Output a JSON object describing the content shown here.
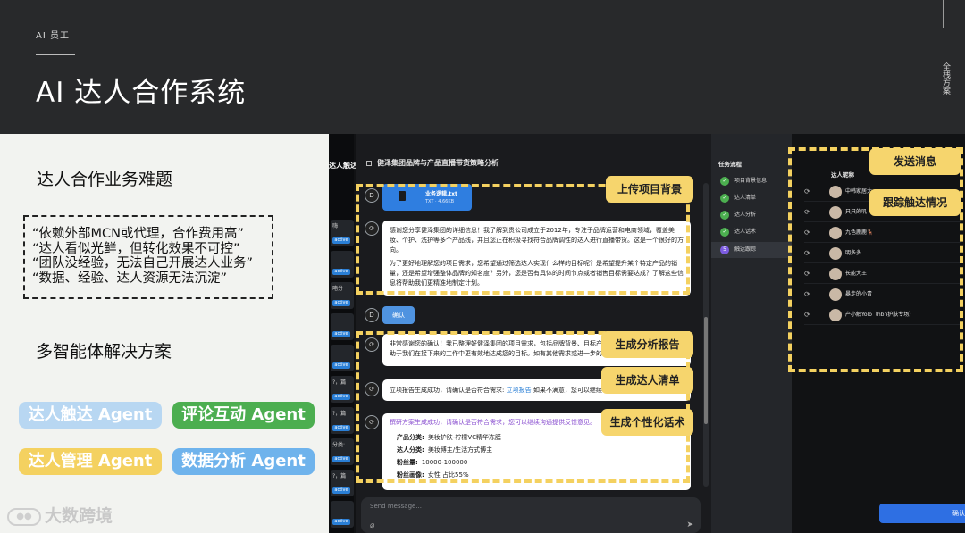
{
  "header": {
    "tag": "AI 员工",
    "title": "AI 达人合作系统",
    "side_text": "全栈方案"
  },
  "left": {
    "problems_title": "达人合作业务难题",
    "quotes": [
      "“依赖外部MCN或代理，合作费用高”",
      "“达人看似光鲜，但转化效果不可控”",
      "“团队没经验，无法自己开展达人业务”",
      "“数据、经验、达人资源无法沉淀”"
    ],
    "solution_title": "多智能体解决方案",
    "agents": [
      "达人触达 Agent",
      "评论互动 Agent",
      "达人管理 Agent",
      "数据分析 Agent"
    ],
    "logo_text": "大数跨境"
  },
  "app": {
    "brand": "达人触达",
    "sidebar_items": [
      {
        "text": "嗨",
        "badge": "active"
      },
      {
        "text": "",
        "badge": "active"
      },
      {
        "text": "略分",
        "badge": "active"
      },
      {
        "text": "",
        "badge": "active"
      },
      {
        "text": "",
        "badge": "active"
      },
      {
        "text": "?，篇",
        "badge": "active"
      },
      {
        "text": "?，篇",
        "badge": "active"
      },
      {
        "text": "分类:",
        "badge": "active"
      },
      {
        "text": "?，篇",
        "badge": "active"
      },
      {
        "text": "",
        "badge": "active"
      }
    ],
    "chat_title": "健泽集团品牌与产品直播带货策略分析",
    "user_avatar": "D",
    "file": {
      "name": "业务逻辑.txt",
      "meta": "TXT · 4.66KB"
    },
    "msg1_p1": "感谢您分享健泽集团的详细信息！我了解到贵公司成立于2012年，专注于品牌运营和电商领域，覆盖美妆、个护、洗护等多个产品线，并且您正在积极寻找符合品牌调性的达人进行直播带货。这是一个很好的方向。",
    "msg1_p2": "为了更好地理解您的项目需求，您希望通过筛选达人实现什么样的目标呢？是希望提升某个特定产品的销量，还是希望增强整体品牌的知名度？另外，您是否有具体的时间节点或者销售目标需要达成？了解这些信息将帮助我们更精准地制定计划。",
    "confirm": "确认",
    "msg2": "非常感谢您的确认！我已整理好健泽集团的项目需求，包括品牌背景、目标产品、达人筛选标准等。这将帮助于我们在接下来的工作中更有效地达成您的目标。如有其他需求或进一步的问题，",
    "msg3_pre": "立项报告生成成功，请确认是否符合需求: ",
    "msg3_link": "立项报告",
    "msg3_post": " 如果不满意，您可以继续",
    "msg4_head": "撰研方案生成成功，请确认是否符合需求，您可以继续沟通提供反馈意见。",
    "msg4_rows": [
      {
        "k": "产品分类:",
        "v": "美妆护肤-柠檬VC精华冻膜"
      },
      {
        "k": "达人分类:",
        "v": "美妆博主/生活方式博主"
      },
      {
        "k": "粉丝量:",
        "v": "10000-100000"
      },
      {
        "k": "粉丝画像:",
        "v": "女性 占比55%"
      }
    ],
    "input_placeholder": "Send message...",
    "tasks_title": "任务流程",
    "tasks": [
      {
        "label": "项目背景信息",
        "mark": "✓"
      },
      {
        "label": "达人清单",
        "mark": "✓"
      },
      {
        "label": "达人分析",
        "mark": "✓"
      },
      {
        "label": "达人话术",
        "mark": "✓"
      },
      {
        "label": "触达跟踪",
        "mark": "5"
      }
    ],
    "people_title": "达人昵称",
    "people": [
      "中韩家居大",
      "只只的叽",
      "九色鹿鹿🦌",
      "明多多",
      "长能大王",
      "暴走的小青",
      "产小触Yolo（hbn护肤专场）"
    ],
    "bottom_button": "确认"
  },
  "annotations": {
    "send_msg": "发送消息",
    "track": "跟踪触达情况",
    "upload": "上传项目背景",
    "report": "生成分析报告",
    "list": "生成达人清单",
    "script": "生成个性化话术"
  }
}
